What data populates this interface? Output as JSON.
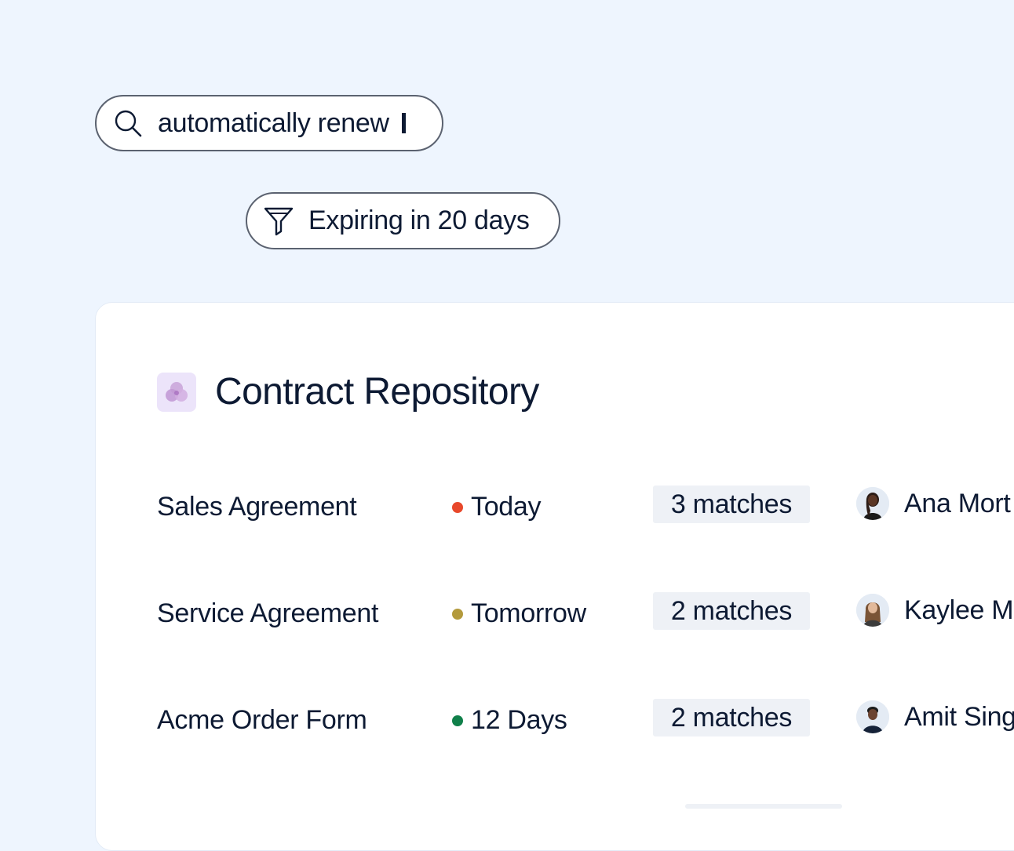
{
  "search": {
    "query": "automatically renew",
    "icon": "search-icon"
  },
  "filter": {
    "label": "Expiring in 20 days",
    "icon": "filter-icon"
  },
  "repository": {
    "title": "Contract Repository",
    "icon": "repository-icon",
    "rows": [
      {
        "name": "Sales Agreement",
        "due": "Today",
        "status_color": "#e8482b",
        "matches": "3 matches",
        "owner": "Ana Mort"
      },
      {
        "name": "Service Agreement",
        "due": "Tomorrow",
        "status_color": "#b39a3c",
        "matches": "2 matches",
        "owner": "Kaylee M"
      },
      {
        "name": "Acme Order Form",
        "due": "12 Days",
        "status_color": "#10804a",
        "matches": "2 matches",
        "owner": "Amit Sing"
      }
    ]
  },
  "colors": {
    "background": "#eef5fe",
    "text": "#0d1a33",
    "pill_border": "#5b6270",
    "match_badge": "#eef1f6",
    "repo_icon_bg": "#ece4fa"
  }
}
